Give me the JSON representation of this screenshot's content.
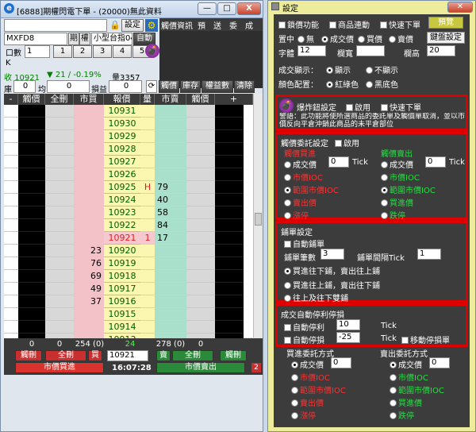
{
  "left_window": {
    "title": "[6888]期權閃電下單 - (20000)無此資料",
    "icon": "e-app-icon",
    "controls": {
      "minimize": "—",
      "maximize": "□",
      "close": "X"
    },
    "toolbar": {
      "settings_label": "設定",
      "buttons": [
        "觸價資訊",
        "預",
        "送",
        "委",
        "成"
      ]
    },
    "product": {
      "symbol": "MXFD8",
      "period_label": "期",
      "right_label": "權",
      "contract": "小型台指04",
      "mode_btn": "自動"
    },
    "qty_row": {
      "label": "口數",
      "value": "1",
      "presets": [
        "1",
        "2",
        "3",
        "4",
        "5"
      ]
    },
    "k_label": "K",
    "quote": {
      "close": "收 10921",
      "change": "▼ 21 / -0.19%",
      "volume": "量3357"
    },
    "pos_row": {
      "label1": "庫",
      "val1": "0",
      "label2": "均",
      "val2": "0",
      "label3": "損益",
      "val3": "0",
      "buttons": [
        "觸價",
        "庫存",
        "權益數",
        "清除"
      ]
    },
    "headers": [
      "觸價",
      "全刪",
      "市買",
      "報價",
      "量",
      "市賣",
      "觸價"
    ],
    "prices": [
      "10931",
      "10930",
      "10929",
      "10928",
      "10927",
      "10926",
      "10925",
      "10924",
      "10923",
      "10922",
      "10921",
      "10920",
      "10919",
      "10918",
      "10917",
      "10916",
      "10915",
      "10914",
      "10913",
      "10912"
    ],
    "buy_qty": [
      "",
      "",
      "",
      "",
      "",
      "",
      "",
      "",
      "",
      "",
      "",
      "23",
      "76",
      "69",
      "49",
      "37",
      "",
      "",
      "",
      ""
    ],
    "sell_qty": [
      "",
      "",
      "",
      "",
      "",
      "",
      "79",
      "40",
      "58",
      "84",
      "17",
      "",
      "",
      "",
      "",
      "",
      "",
      "",
      "",
      ""
    ],
    "vol": [
      "",
      "",
      "",
      "",
      "",
      "",
      "H",
      "",
      "",
      "",
      "1",
      "",
      "",
      "",
      "",
      "",
      "",
      "",
      "",
      "L"
    ],
    "footer": {
      "totals": [
        "0",
        "0",
        "254 (0)",
        "24",
        "278 (0)",
        "0"
      ],
      "del_left": "觸刪",
      "all_del_left": "全刪",
      "buy_small": "買",
      "price_val": "10921",
      "sell_small": "賣",
      "all_del_right": "全刪",
      "del_right": "觸刪",
      "market_buy": "市價買進",
      "time": "16:07:28",
      "market_sell": "市價賣出",
      "badge": "2"
    }
  },
  "right_window": {
    "title": "設定",
    "close": "✕",
    "row1": [
      "鎖價功能",
      "商品連動",
      "快速下單"
    ],
    "preview_btn": "預覽",
    "center_label": "置中",
    "center_opts": [
      "無",
      "成交價",
      "買價",
      "賣價"
    ],
    "key_btn": "鍵盤設定",
    "font_label": "字體",
    "font_val": "12",
    "width_label": "欄寬",
    "width_val": "",
    "height_label": "欄高",
    "height_val": "20",
    "deal_label": "成交顯示：",
    "deal_opts": [
      "顯示",
      "不顯示"
    ],
    "color_label": "顏色配置：",
    "color_opts": [
      "紅綠色",
      "黑底色"
    ],
    "bomb": {
      "icon": "bomb-icon",
      "label": "爆炸鈕設定",
      "enable": "啟用",
      "fast": "快速下單",
      "warning": "警語：此功能將使所選商品的委託單及觸價單取消，並以市價反向平倉沖銷此商品的未平倉部位"
    },
    "trigger": {
      "title": "觸價委託設定",
      "enable": "啟用",
      "buy_title": "觸價買進",
      "sell_title": "觸價賣出",
      "buy_opts": [
        "成交價",
        "市價IOC",
        "範圍市價IOC",
        "賣出價",
        "漲停"
      ],
      "sell_opts": [
        "成交價",
        "市價IOC",
        "範圍市價IOC",
        "買進價",
        "跌停"
      ],
      "tick_val": "0",
      "tick": "Tick"
    },
    "fill": {
      "title": "鋪單設定",
      "auto": "自動鋪單",
      "count_label": "鋪單筆數",
      "count_val": "3",
      "gap_label": "鋪單間隔Tick",
      "gap_val": "1",
      "opts": [
        "買進往下鋪，賣出往上鋪",
        "買進往上鋪，賣出往下鋪",
        "往上及往下雙鋪"
      ]
    },
    "stop": {
      "title": "成交自動停利停損",
      "profit": "自動停利",
      "profit_val": "10",
      "loss": "自動停損",
      "loss_val": "-25",
      "tick": "Tick",
      "move": "移動停損單"
    },
    "buy_order": {
      "title": "買進委託方式",
      "opts": [
        "成交價",
        "市價IOC",
        "範圍市價IOC",
        "賣出價",
        "漲停"
      ]
    },
    "sell_order": {
      "title": "賣出委託方式",
      "opts": [
        "成交價",
        "市價IOC",
        "範圍市價IOC",
        "買進價",
        "跌停"
      ]
    },
    "tick_val": "0"
  }
}
